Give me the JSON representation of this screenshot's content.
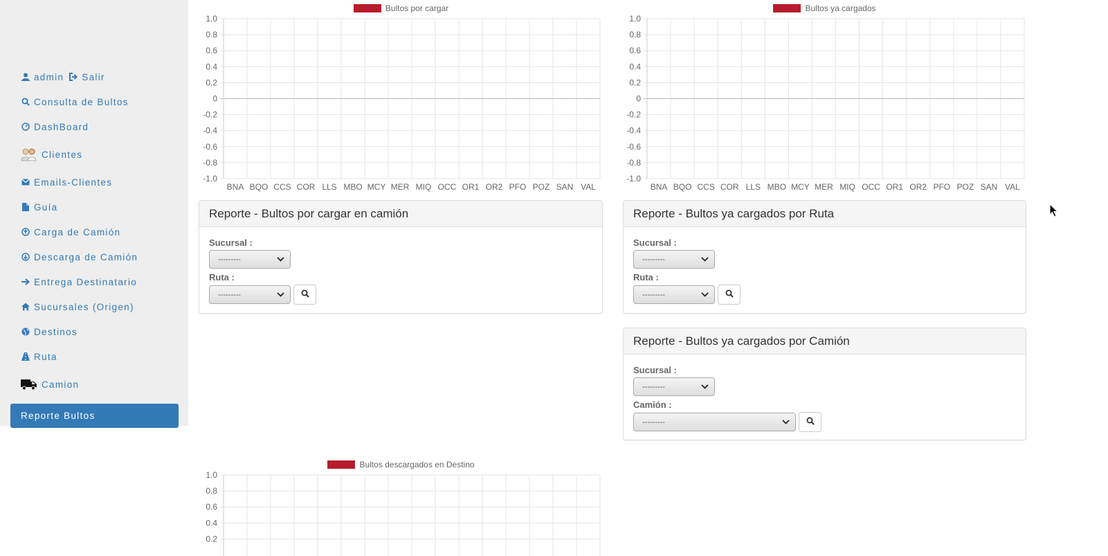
{
  "sidebar": {
    "user": "admin",
    "logout": "Salir",
    "items": [
      {
        "label": "Consulta de Bultos",
        "icon": "search-icon"
      },
      {
        "label": "DashBoard",
        "icon": "dashboard-icon"
      },
      {
        "label": "Clientes",
        "icon": "users-icon"
      },
      {
        "label": "Emails-Clientes",
        "icon": "envelope-icon"
      },
      {
        "label": "Guía",
        "icon": "file-icon"
      },
      {
        "label": "Carga de Camión",
        "icon": "upload-circle-icon"
      },
      {
        "label": "Descarga de Camión",
        "icon": "download-circle-icon"
      },
      {
        "label": "Entrega Destinatario",
        "icon": "arrow-right-icon"
      },
      {
        "label": "Sucursales (Origen)",
        "icon": "home-icon"
      },
      {
        "label": "Destinos",
        "icon": "globe-icon"
      },
      {
        "label": "Ruta",
        "icon": "road-icon"
      },
      {
        "label": "Camion",
        "icon": "truck-icon"
      },
      {
        "label": "Reporte Bultos",
        "icon": "",
        "active": true
      }
    ]
  },
  "chart_data": [
    {
      "type": "bar",
      "legend": "Bultos por cargar",
      "legend_color": "#b71c2c",
      "categories": [
        "BNA",
        "BQO",
        "CCS",
        "COR",
        "LLS",
        "MBO",
        "MCY",
        "MER",
        "MIQ",
        "OCC",
        "OR1",
        "OR2",
        "PFO",
        "POZ",
        "SAN",
        "VAL"
      ],
      "series": [
        {
          "name": "Bultos por cargar",
          "values": []
        }
      ],
      "yticks": [
        "1.0",
        "0.8",
        "0.6",
        "0.4",
        "0.2",
        "0",
        "-0.2",
        "-0.4",
        "-0.6",
        "-0.8",
        "-1.0"
      ],
      "ylim": [
        -1,
        1
      ],
      "grid": true
    },
    {
      "type": "bar",
      "legend": "Bultos ya cargados",
      "legend_color": "#b71c2c",
      "categories": [
        "BNA",
        "BQO",
        "CCS",
        "COR",
        "LLS",
        "MBO",
        "MCY",
        "MER",
        "MIQ",
        "OCC",
        "OR1",
        "OR2",
        "PFO",
        "POZ",
        "SAN",
        "VAL"
      ],
      "series": [
        {
          "name": "Bultos ya cargados",
          "values": []
        }
      ],
      "yticks": [
        "1.0",
        "0.8",
        "0.6",
        "0.4",
        "0.2",
        "0",
        "-0.2",
        "-0.4",
        "-0.6",
        "-0.8",
        "-1.0"
      ],
      "ylim": [
        -1,
        1
      ],
      "grid": true
    },
    {
      "type": "bar",
      "legend": "Bultos descargados en Destino",
      "legend_color": "#b71c2c",
      "categories": [],
      "series": [
        {
          "name": "Bultos descargados en Destino",
          "values": []
        }
      ],
      "yticks": [
        "1.0",
        "0.8",
        "0.6",
        "0.4",
        "0.2"
      ],
      "ylim": [
        -1,
        1
      ],
      "grid": true
    }
  ],
  "panels": {
    "cargar": {
      "title": "Reporte - Bultos por cargar en camión",
      "sucursal_label": "Sucursal :",
      "sucursal_value": "---------",
      "ruta_label": "Ruta :",
      "ruta_value": "---------"
    },
    "ruta": {
      "title": "Reporte - Bultos ya cargados por Ruta",
      "sucursal_label": "Sucursal :",
      "sucursal_value": "---------",
      "ruta_label": "Ruta :",
      "ruta_value": "---------"
    },
    "camion": {
      "title": "Reporte - Bultos ya cargados por Camión",
      "sucursal_label": "Sucursal :",
      "sucursal_value": "---------",
      "camion_label": "Camión :",
      "camion_value": "---------"
    }
  },
  "colors": {
    "link": "#337ab7",
    "sidebar_bg": "#eeeeee",
    "legend_red": "#b71c2c"
  }
}
